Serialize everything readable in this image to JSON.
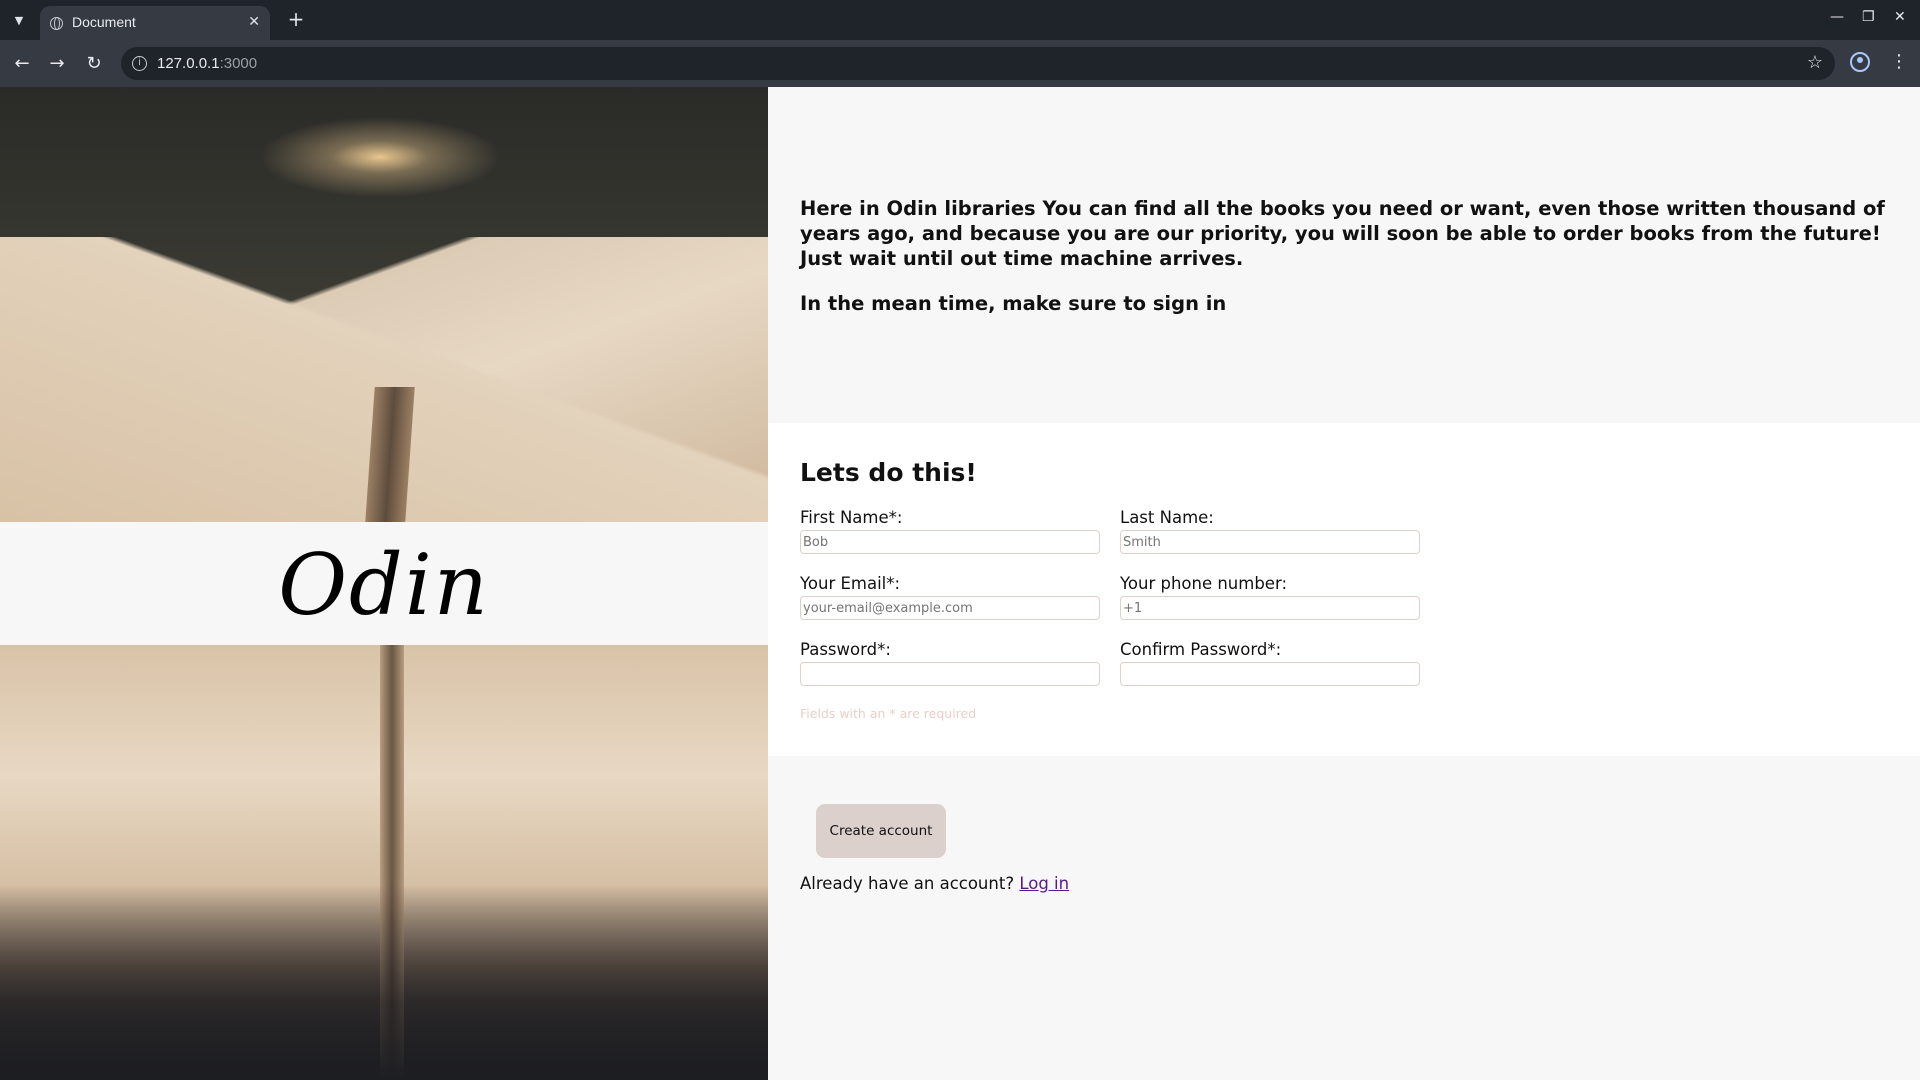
{
  "browser": {
    "tab_title": "Document",
    "url_host": "127.0.0.1",
    "url_port": ":3000"
  },
  "brand": {
    "name": "Odin"
  },
  "intro": {
    "paragraph1": "Here in Odin libraries You can find all the books you need or want, even those written thousand of years ago, and because you are our priority, you will soon be able to order books from the future! Just wait until out time machine arrives.",
    "paragraph2": "In the mean time, make sure to sign in"
  },
  "form": {
    "heading": "Lets do this!",
    "first_name": {
      "label": "First Name*:",
      "placeholder": "Bob",
      "value": ""
    },
    "last_name": {
      "label": "Last Name:",
      "placeholder": "Smith",
      "value": ""
    },
    "email": {
      "label": "Your Email*:",
      "placeholder": "your-email@example.com",
      "value": ""
    },
    "phone": {
      "label": "Your phone number:",
      "placeholder": "+1",
      "value": ""
    },
    "password": {
      "label": "Password*:",
      "placeholder": "",
      "value": ""
    },
    "confirm_password": {
      "label": "Confirm Password*:",
      "placeholder": "",
      "value": ""
    },
    "required_note": "Fields with an * are required"
  },
  "actions": {
    "create_button": "Create account",
    "login_prompt": "Already have an account?",
    "login_link": "Log in"
  },
  "colors": {
    "button_bg": "#dcd0cc",
    "input_border": "#e0d0cc",
    "link": "#551a8b",
    "page_bg": "#f7f7f7"
  }
}
